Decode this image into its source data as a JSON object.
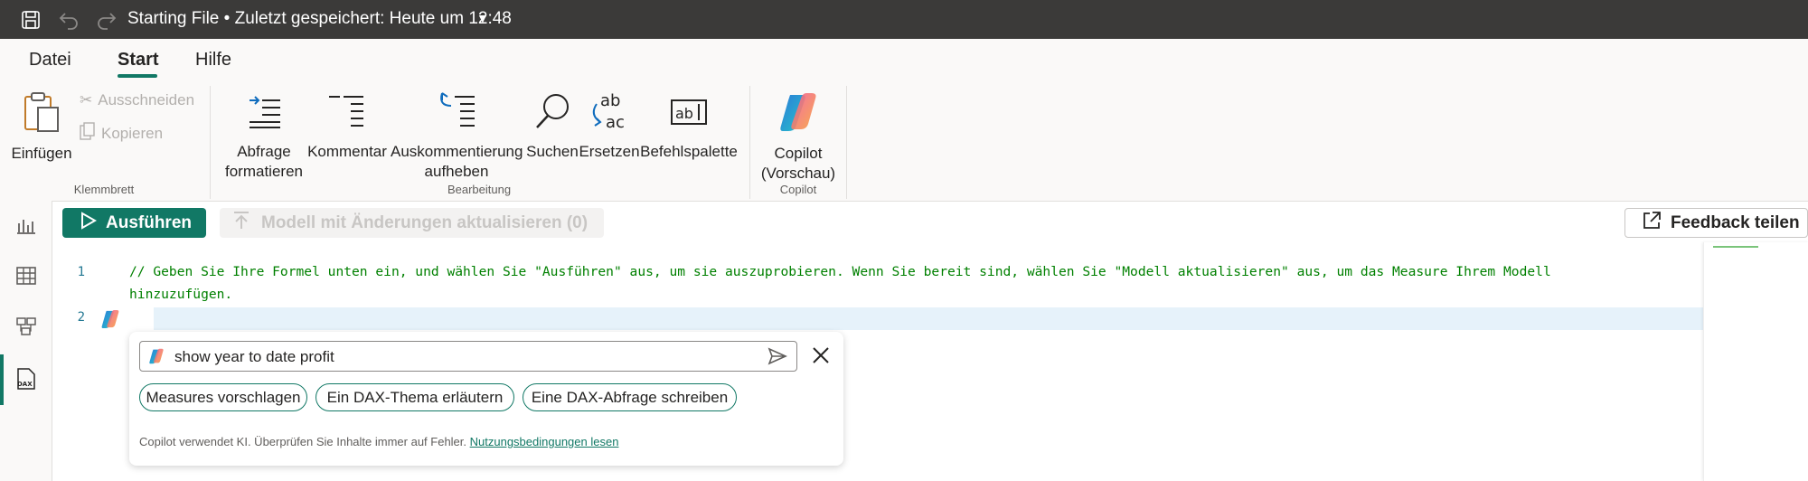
{
  "titlebar": {
    "title": "Starting File • Zuletzt gespeichert: Heute um 12:48",
    "icons": [
      "save-icon",
      "undo-icon",
      "redo-icon",
      "chevron-down-icon"
    ]
  },
  "tabs": [
    {
      "label": "Datei"
    },
    {
      "label": "Start",
      "active": true
    },
    {
      "label": "Hilfe"
    }
  ],
  "ribbon": {
    "clipboard": {
      "paste": "Einfügen",
      "cut": "Ausschneiden",
      "copy": "Kopieren",
      "group": "Klemmbrett"
    },
    "editing": {
      "format_line1": "Abfrage",
      "format_line2": "formatieren",
      "comment": "Kommentar",
      "uncomment_line1": "Auskommentierung",
      "uncomment_line2": "aufheben",
      "search": "Suchen",
      "replace": "Ersetzen",
      "command_palette": "Befehlspalette",
      "group": "Bearbeitung"
    },
    "copilot": {
      "label_line1": "Copilot",
      "label_line2": "(Vorschau)",
      "group": "Copilot"
    }
  },
  "toolbar": {
    "run": "Ausführen",
    "update_model": "Modell mit Änderungen aktualisieren (0)",
    "feedback": "Feedback teilen"
  },
  "editor": {
    "lines": [
      {
        "number": "1",
        "text": "// Geben Sie Ihre Formel unten ein, und wählen Sie \"Ausführen\" aus, um sie auszuprobieren. Wenn Sie bereit sind, wählen Sie \"Modell aktualisieren\" aus, um das Measure Ihrem Modell",
        "continuation": "hinzuzufügen."
      },
      {
        "number": "2",
        "text": ""
      }
    ]
  },
  "copilot_popup": {
    "input_value": "show year to date profit",
    "suggestions": [
      "Measures vorschlagen",
      "Ein DAX-Thema erläutern",
      "Eine DAX-Abfrage schreiben"
    ],
    "disclaimer": "Copilot verwendet KI. Überprüfen Sie Inhalte immer auf Fehler.",
    "terms_link": "Nutzungsbedingungen lesen"
  },
  "colors": {
    "accent": "#117865",
    "titlebar": "#3b3a39",
    "comment": "#008000"
  }
}
